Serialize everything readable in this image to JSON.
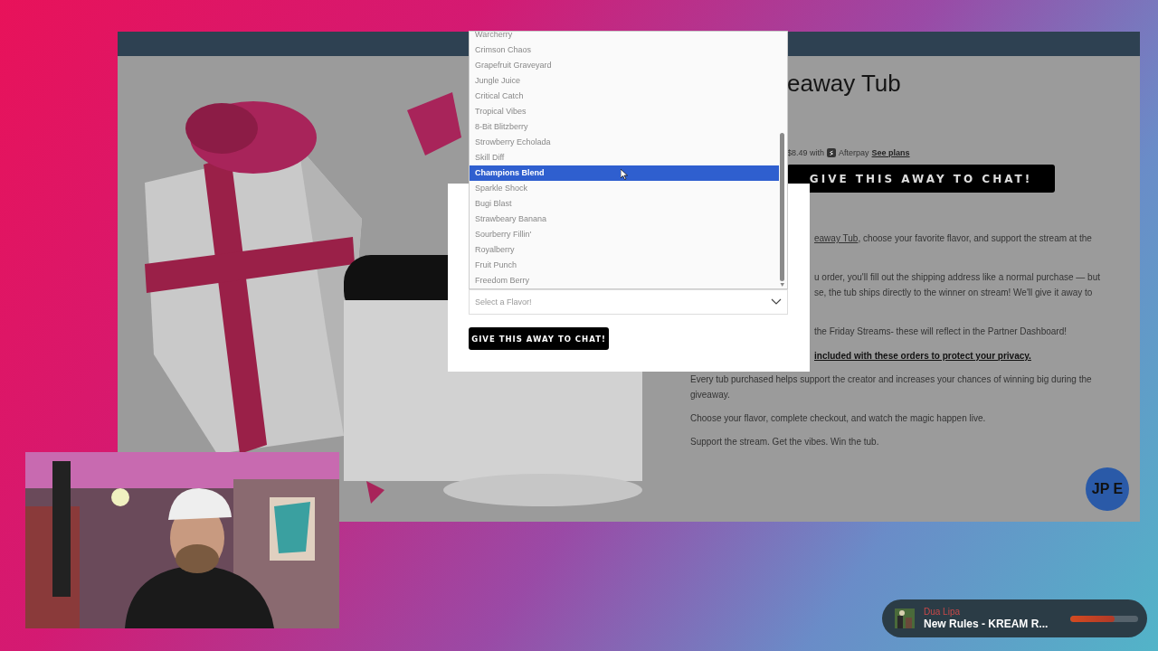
{
  "page": {
    "product_title": "eaway Tub",
    "price": {
      "text": "$8.49 with",
      "provider": "Afterpay",
      "link": "See plans"
    },
    "cta": "GIVE THIS AWAY TO CHAT!",
    "partial_paragraphs": [
      [
        {
          "link": "eaway Tub",
          "text": ", choose your favorite flavor, and support the stream at the"
        }
      ],
      [
        {
          "text": "u order, you'll fill out the shipping address like a normal purchase — but"
        },
        {
          "text": "se, the tub ships directly to the winner on stream! We'll give it away to"
        }
      ],
      [
        {
          "text": "the Friday Streams- these will reflect in the Partner Dashboard!"
        }
      ]
    ],
    "privacy_note": "included with these orders to protect your privacy.",
    "paragraphs": [
      "Every tub purchased helps support the creator and increases your chances of winning big during the giveaway.",
      "Choose your flavor, complete checkout, and watch the magic happen live.",
      "Support the stream. Get the vibes. Win the tub."
    ],
    "chat_badge": "JP E"
  },
  "modal": {
    "select_placeholder": "Select a Flavor!",
    "button": "GIVE THIS AWAY TO CHAT!",
    "flavors": [
      {
        "label": "Warcherry",
        "selected": false
      },
      {
        "label": "Crimson Chaos",
        "selected": false
      },
      {
        "label": "Grapefruit Graveyard",
        "selected": false
      },
      {
        "label": "Jungle Juice",
        "selected": false
      },
      {
        "label": "Critical Catch",
        "selected": false
      },
      {
        "label": "Tropical Vibes",
        "selected": false
      },
      {
        "label": "8-Bit Blitzberry",
        "selected": false
      },
      {
        "label": "Strowberry Echolada",
        "selected": false
      },
      {
        "label": "Skill Diff",
        "selected": false
      },
      {
        "label": "Champions Blend",
        "selected": true
      },
      {
        "label": "Sparkle Shock",
        "selected": false
      },
      {
        "label": "Bugi Blast",
        "selected": false
      },
      {
        "label": "Strawbeary Banana",
        "selected": false
      },
      {
        "label": "Sourberry Fillin'",
        "selected": false
      },
      {
        "label": "Royalberry",
        "selected": false
      },
      {
        "label": "Fruit Punch",
        "selected": false
      },
      {
        "label": "Freedom Berry",
        "selected": false
      }
    ]
  },
  "music": {
    "artist": "Dua Lipa",
    "title": "New Rules - KREAM R...",
    "level": 0.65
  }
}
